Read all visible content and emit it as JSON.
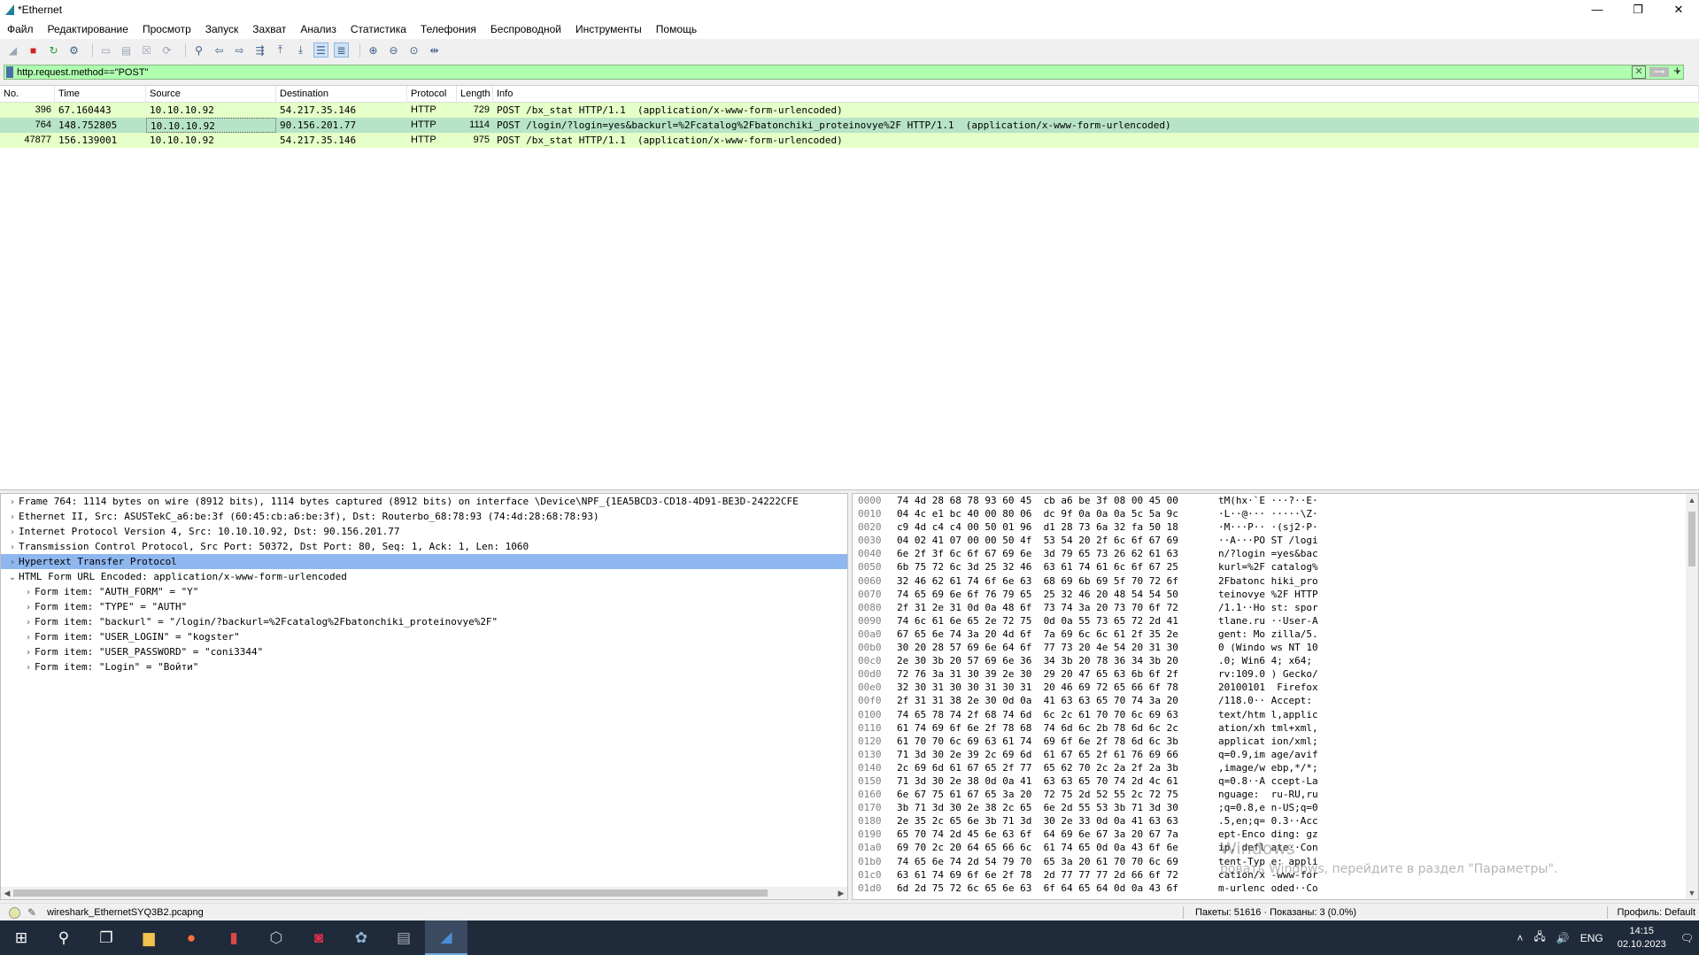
{
  "window": {
    "title": "*Ethernet",
    "min": "—",
    "max": "❐",
    "close": "✕"
  },
  "menu": [
    "Файл",
    "Редактирование",
    "Просмотр",
    "Запуск",
    "Захват",
    "Анализ",
    "Статистика",
    "Телефония",
    "Беспроводной",
    "Инструменты",
    "Помощь"
  ],
  "filter": {
    "value": "http.request.method==\"POST\"",
    "clear": "✕",
    "apply": "⟹",
    "dropdown": "▾",
    "plus": "+"
  },
  "packet_list": {
    "columns": [
      "No.",
      "Time",
      "Source",
      "Destination",
      "Protocol",
      "Length",
      "Info"
    ],
    "rows": [
      {
        "no": "396",
        "time": "67.160443",
        "src": "10.10.10.92",
        "dst": "54.217.35.146",
        "proto": "HTTP",
        "len": "729",
        "info": "POST /bx_stat HTTP/1.1  (application/x-www-form-urlencoded)",
        "selected": false
      },
      {
        "no": "764",
        "time": "148.752805",
        "src": "10.10.10.92",
        "dst": "90.156.201.77",
        "proto": "HTTP",
        "len": "1114",
        "info": "POST /login/?login=yes&backurl=%2Fcatalog%2Fbatonchiki_proteinovye%2F HTTP/1.1  (application/x-www-form-urlencoded)",
        "selected": true
      },
      {
        "no": "47877",
        "time": "156.139001",
        "src": "10.10.10.92",
        "dst": "54.217.35.146",
        "proto": "HTTP",
        "len": "975",
        "info": "POST /bx_stat HTTP/1.1  (application/x-www-form-urlencoded)",
        "selected": false
      }
    ]
  },
  "details": {
    "rows": [
      {
        "arrow": "›",
        "text": "Frame 764: 1114 bytes on wire (8912 bits), 1114 bytes captured (8912 bits) on interface \\Device\\NPF_{1EA5BCD3-CD18-4D91-BE3D-24222CFE",
        "level": 0,
        "hl": false
      },
      {
        "arrow": "›",
        "text": "Ethernet II, Src: ASUSTekC_a6:be:3f (60:45:cb:a6:be:3f), Dst: Routerbo_68:78:93 (74:4d:28:68:78:93)",
        "level": 0,
        "hl": false
      },
      {
        "arrow": "›",
        "text": "Internet Protocol Version 4, Src: 10.10.10.92, Dst: 90.156.201.77",
        "level": 0,
        "hl": false
      },
      {
        "arrow": "›",
        "text": "Transmission Control Protocol, Src Port: 50372, Dst Port: 80, Seq: 1, Ack: 1, Len: 1060",
        "level": 0,
        "hl": false
      },
      {
        "arrow": "›",
        "text": "Hypertext Transfer Protocol",
        "level": 0,
        "hl": true
      },
      {
        "arrow": "⌄",
        "text": "HTML Form URL Encoded: application/x-www-form-urlencoded",
        "level": 0,
        "hl": false
      },
      {
        "arrow": "›",
        "text": "Form item: \"AUTH_FORM\" = \"Y\"",
        "level": 1,
        "hl": false
      },
      {
        "arrow": "›",
        "text": "Form item: \"TYPE\" = \"AUTH\"",
        "level": 1,
        "hl": false
      },
      {
        "arrow": "›",
        "text": "Form item: \"backurl\" = \"/login/?backurl=%2Fcatalog%2Fbatonchiki_proteinovye%2F\"",
        "level": 1,
        "hl": false
      },
      {
        "arrow": "›",
        "text": "Form item: \"USER_LOGIN\" = \"kogster\"",
        "level": 1,
        "hl": false
      },
      {
        "arrow": "›",
        "text": "Form item: \"USER_PASSWORD\" = \"coni3344\"",
        "level": 1,
        "hl": false
      },
      {
        "arrow": "›",
        "text": "Form item: \"Login\" = \"Войти\"",
        "level": 1,
        "hl": false
      }
    ]
  },
  "bytes": [
    {
      "off": "0000",
      "hex": "74 4d 28 68 78 93 60 45  cb a6 be 3f 08 00 45 00",
      "asc": "tM(hx·`E ···?··E·"
    },
    {
      "off": "0010",
      "hex": "04 4c e1 bc 40 00 80 06  dc 9f 0a 0a 0a 5c 5a 9c",
      "asc": "·L··@··· ·····\\Z·"
    },
    {
      "off": "0020",
      "hex": "c9 4d c4 c4 00 50 01 96  d1 28 73 6a 32 fa 50 18",
      "asc": "·M···P·· ·(sj2·P·"
    },
    {
      "off": "0030",
      "hex": "04 02 41 07 00 00 50 4f  53 54 20 2f 6c 6f 67 69",
      "asc": "··A···PO ST /logi"
    },
    {
      "off": "0040",
      "hex": "6e 2f 3f 6c 6f 67 69 6e  3d 79 65 73 26 62 61 63",
      "asc": "n/?login =yes&bac"
    },
    {
      "off": "0050",
      "hex": "6b 75 72 6c 3d 25 32 46  63 61 74 61 6c 6f 67 25",
      "asc": "kurl=%2F catalog%"
    },
    {
      "off": "0060",
      "hex": "32 46 62 61 74 6f 6e 63  68 69 6b 69 5f 70 72 6f",
      "asc": "2Fbatonc hiki_pro"
    },
    {
      "off": "0070",
      "hex": "74 65 69 6e 6f 76 79 65  25 32 46 20 48 54 54 50",
      "asc": "teinovye %2F HTTP"
    },
    {
      "off": "0080",
      "hex": "2f 31 2e 31 0d 0a 48 6f  73 74 3a 20 73 70 6f 72",
      "asc": "/1.1··Ho st: spor"
    },
    {
      "off": "0090",
      "hex": "74 6c 61 6e 65 2e 72 75  0d 0a 55 73 65 72 2d 41",
      "asc": "tlane.ru ··User-A"
    },
    {
      "off": "00a0",
      "hex": "67 65 6e 74 3a 20 4d 6f  7a 69 6c 6c 61 2f 35 2e",
      "asc": "gent: Mo zilla/5."
    },
    {
      "off": "00b0",
      "hex": "30 20 28 57 69 6e 64 6f  77 73 20 4e 54 20 31 30",
      "asc": "0 (Windo ws NT 10"
    },
    {
      "off": "00c0",
      "hex": "2e 30 3b 20 57 69 6e 36  34 3b 20 78 36 34 3b 20",
      "asc": ".0; Win6 4; x64; "
    },
    {
      "off": "00d0",
      "hex": "72 76 3a 31 30 39 2e 30  29 20 47 65 63 6b 6f 2f",
      "asc": "rv:109.0 ) Gecko/"
    },
    {
      "off": "00e0",
      "hex": "32 30 31 30 30 31 30 31  20 46 69 72 65 66 6f 78",
      "asc": "20100101  Firefox"
    },
    {
      "off": "00f0",
      "hex": "2f 31 31 38 2e 30 0d 0a  41 63 63 65 70 74 3a 20",
      "asc": "/118.0·· Accept: "
    },
    {
      "off": "0100",
      "hex": "74 65 78 74 2f 68 74 6d  6c 2c 61 70 70 6c 69 63",
      "asc": "text/htm l,applic"
    },
    {
      "off": "0110",
      "hex": "61 74 69 6f 6e 2f 78 68  74 6d 6c 2b 78 6d 6c 2c",
      "asc": "ation/xh tml+xml,"
    },
    {
      "off": "0120",
      "hex": "61 70 70 6c 69 63 61 74  69 6f 6e 2f 78 6d 6c 3b",
      "asc": "applicat ion/xml;"
    },
    {
      "off": "0130",
      "hex": "71 3d 30 2e 39 2c 69 6d  61 67 65 2f 61 76 69 66",
      "asc": "q=0.9,im age/avif"
    },
    {
      "off": "0140",
      "hex": "2c 69 6d 61 67 65 2f 77  65 62 70 2c 2a 2f 2a 3b",
      "asc": ",image/w ebp,*/*;"
    },
    {
      "off": "0150",
      "hex": "71 3d 30 2e 38 0d 0a 41  63 63 65 70 74 2d 4c 61",
      "asc": "q=0.8··A ccept-La"
    },
    {
      "off": "0160",
      "hex": "6e 67 75 61 67 65 3a 20  72 75 2d 52 55 2c 72 75",
      "asc": "nguage:  ru-RU,ru"
    },
    {
      "off": "0170",
      "hex": "3b 71 3d 30 2e 38 2c 65  6e 2d 55 53 3b 71 3d 30",
      "asc": ";q=0.8,e n-US;q=0"
    },
    {
      "off": "0180",
      "hex": "2e 35 2c 65 6e 3b 71 3d  30 2e 33 0d 0a 41 63 63",
      "asc": ".5,en;q= 0.3··Acc"
    },
    {
      "off": "0190",
      "hex": "65 70 74 2d 45 6e 63 6f  64 69 6e 67 3a 20 67 7a",
      "asc": "ept-Enco ding: gz"
    },
    {
      "off": "01a0",
      "hex": "69 70 2c 20 64 65 66 6c  61 74 65 0d 0a 43 6f 6e",
      "asc": "ip, defl ate··Con"
    },
    {
      "off": "01b0",
      "hex": "74 65 6e 74 2d 54 79 70  65 3a 20 61 70 70 6c 69",
      "asc": "tent-Typ e: appli"
    },
    {
      "off": "01c0",
      "hex": "63 61 74 69 6f 6e 2f 78  2d 77 77 77 2d 66 6f 72",
      "asc": "cation/x -www-for"
    },
    {
      "off": "01d0",
      "hex": "6d 2d 75 72 6c 65 6e 63  6f 64 65 64 0d 0a 43 6f",
      "asc": "m-urlenc oded··Co"
    }
  ],
  "watermark": {
    "line1": "Windows",
    "line2": "ровать Windows, перейдите в раздел \"Параметры\"."
  },
  "status": {
    "file": "wireshark_EthernetSYQ3B2.pcapng",
    "packets": "Пакеты: 51616 · Показаны: 3 (0.0%)",
    "profile": "Профиль: Default"
  },
  "taskbar": {
    "lang": "ENG",
    "time": "14:15",
    "date": "02.10.2023"
  }
}
